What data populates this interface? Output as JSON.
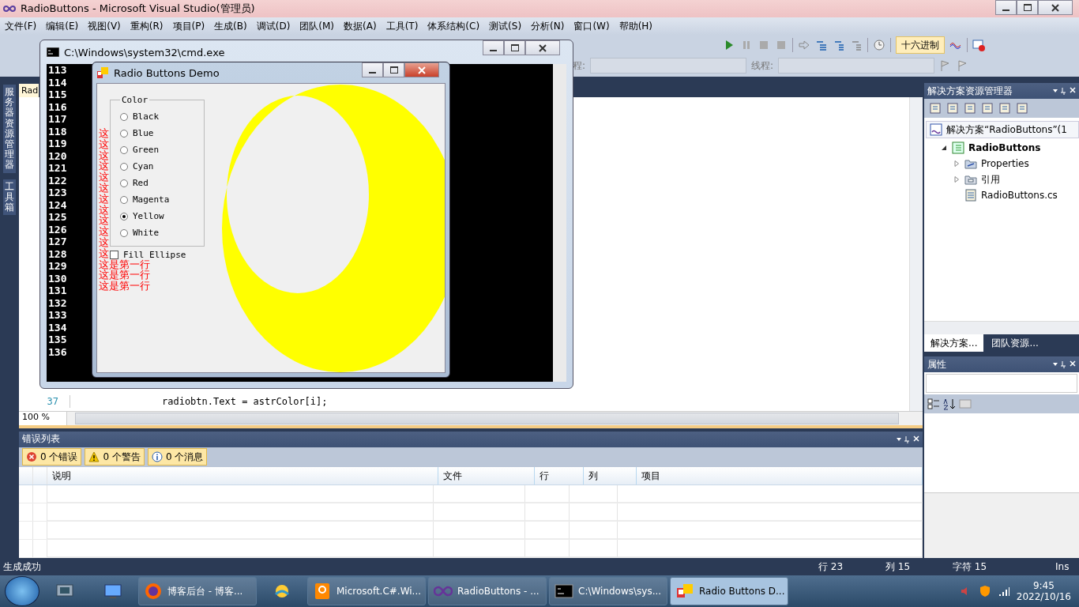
{
  "vs": {
    "title": "RadioButtons - Microsoft Visual Studio(管理员)",
    "menu": [
      "文件(F)",
      "编辑(E)",
      "视图(V)",
      "重构(R)",
      "项目(P)",
      "生成(B)",
      "调试(D)",
      "团队(M)",
      "数据(A)",
      "工具(T)",
      "体系结构(C)",
      "测试(S)",
      "分析(N)",
      "窗口(W)",
      "帮助(H)"
    ],
    "toolbar": {
      "hex_button": {
        "label": "十六进制",
        "selected": true
      },
      "process_label": "程:",
      "thread_label": "线程:"
    },
    "side_tabs": [
      "服务器资源管理器",
      "工具箱"
    ],
    "editor": {
      "tab": "Rad",
      "lines": [
        {
          "number": "37",
          "code": "radiobtn.Text = astrColor[i];"
        }
      ],
      "zoom": "100 %"
    },
    "solution_explorer": {
      "title": "解决方案资源管理器",
      "tree": [
        {
          "label": "解决方案“RadioButtons”(1",
          "kind": "solution",
          "children": [
            {
              "label": "RadioButtons",
              "kind": "project",
              "expanded": true,
              "children": [
                {
                  "label": "Properties",
                  "kind": "folder",
                  "expanded": false
                },
                {
                  "label": "引用",
                  "kind": "references",
                  "expanded": false
                },
                {
                  "label": "RadioButtons.cs",
                  "kind": "file"
                }
              ]
            }
          ]
        }
      ],
      "tabs": [
        {
          "label": "解决方案...",
          "selected": true
        },
        {
          "label": "团队资源...",
          "selected": false
        }
      ]
    },
    "properties": {
      "title": "属性"
    },
    "error_list": {
      "title": "错误列表",
      "filters": [
        {
          "kind": "error",
          "label": "0 个错误"
        },
        {
          "kind": "warning",
          "label": "0 个警告"
        },
        {
          "kind": "info",
          "label": "0 个消息"
        }
      ],
      "columns": [
        "说明",
        "文件",
        "行",
        "列",
        "项目"
      ]
    },
    "status_bar": {
      "message": "生成成功",
      "line": "行 23",
      "column": "列 15",
      "char": "字符 15",
      "mode": "Ins"
    }
  },
  "cmd_window": {
    "title": "C:\\Windows\\system32\\cmd.exe",
    "lines": [
      "113",
      "114",
      "115",
      "116",
      "117",
      "118",
      "119",
      "120",
      "121",
      "122",
      "123",
      "124",
      "125",
      "126",
      "127",
      "128",
      "129",
      "130",
      "131",
      "132",
      "133",
      "134",
      "135",
      "136"
    ]
  },
  "demo_window": {
    "title": "Radio Buttons Demo",
    "group_label": "Color",
    "options": [
      {
        "label": "Black",
        "selected": false
      },
      {
        "label": "Blue",
        "selected": false
      },
      {
        "label": "Green",
        "selected": false
      },
      {
        "label": "Cyan",
        "selected": false
      },
      {
        "label": "Red",
        "selected": false
      },
      {
        "label": "Magenta",
        "selected": false
      },
      {
        "label": "Yellow",
        "selected": true
      },
      {
        "label": "White",
        "selected": false
      }
    ],
    "fill_ellipse": {
      "label": "Fill Ellipse",
      "checked": false
    },
    "overlay_text": [
      "这",
      "这",
      "这",
      "这",
      "这",
      "这",
      "这",
      "这",
      "这",
      "这",
      "这",
      "这",
      "这是第一行",
      "这是第一行",
      "这是第一行"
    ]
  },
  "taskbar": {
    "items": [
      {
        "kind": "pinned"
      },
      {
        "kind": "desktop"
      },
      {
        "kind": "browser",
        "label": "博客后台 - 博客...",
        "selected": false
      },
      {
        "kind": "weather"
      },
      {
        "kind": "pdf",
        "label": "Microsoft.C#.Wi...",
        "selected": false
      },
      {
        "kind": "vs",
        "label": "RadioButtons - ...",
        "selected": false
      },
      {
        "kind": "console",
        "label": "C:\\Windows\\sys...",
        "selected": false
      },
      {
        "kind": "winform",
        "label": "Radio Buttons D...",
        "selected": true
      }
    ],
    "time": "9:45",
    "date": "2022/10/16"
  }
}
